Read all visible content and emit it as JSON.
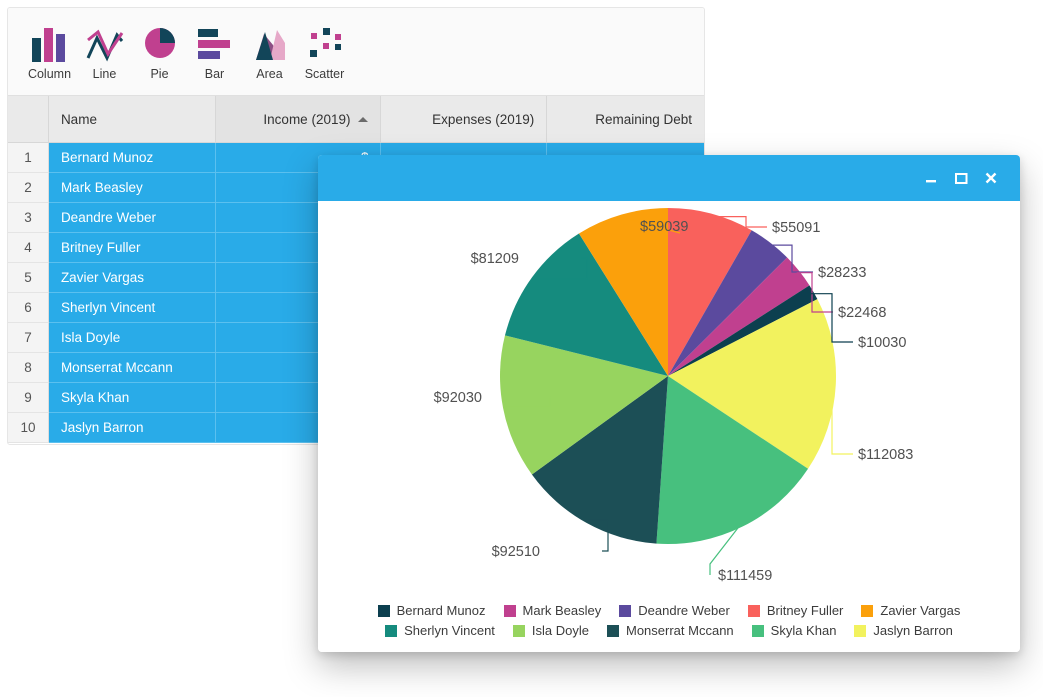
{
  "toolbar": {
    "items": [
      {
        "label": "Column",
        "icon": "column-chart-icon"
      },
      {
        "label": "Line",
        "icon": "line-chart-icon"
      },
      {
        "label": "Pie",
        "icon": "pie-chart-icon"
      },
      {
        "label": "Bar",
        "icon": "bar-chart-icon"
      },
      {
        "label": "Area",
        "icon": "area-chart-icon"
      },
      {
        "label": "Scatter",
        "icon": "scatter-chart-icon"
      }
    ]
  },
  "grid": {
    "columns": [
      {
        "key": "rownum",
        "label": ""
      },
      {
        "key": "name",
        "label": "Name"
      },
      {
        "key": "income",
        "label": "Income (2019)",
        "sorted": "ascending"
      },
      {
        "key": "expenses",
        "label": "Expenses (2019)"
      },
      {
        "key": "debt",
        "label": "Remaining Debt"
      }
    ],
    "rows": [
      {
        "num": "1",
        "name": "Bernard Munoz",
        "income": "$",
        "expenses": "",
        "debt": ""
      },
      {
        "num": "2",
        "name": "Mark Beasley",
        "income": "$",
        "expenses": "",
        "debt": ""
      },
      {
        "num": "3",
        "name": "Deandre Weber",
        "income": "$",
        "expenses": "",
        "debt": ""
      },
      {
        "num": "4",
        "name": "Britney Fuller",
        "income": "$",
        "expenses": "",
        "debt": ""
      },
      {
        "num": "5",
        "name": "Zavier Vargas",
        "income": "$",
        "expenses": "",
        "debt": ""
      },
      {
        "num": "6",
        "name": "Sherlyn Vincent",
        "income": "$",
        "expenses": "",
        "debt": ""
      },
      {
        "num": "7",
        "name": "Isla Doyle",
        "income": "$",
        "expenses": "",
        "debt": ""
      },
      {
        "num": "8",
        "name": "Monserrat Mccann",
        "income": "$",
        "expenses": "",
        "debt": ""
      },
      {
        "num": "9",
        "name": "Skyla Khan",
        "income": "$",
        "expenses": "",
        "debt": ""
      },
      {
        "num": "10",
        "name": "Jaslyn Barron",
        "income": "$",
        "expenses": "",
        "debt": ""
      }
    ]
  },
  "window": {
    "title": "",
    "buttons": [
      {
        "name": "minimize",
        "glyph": "—"
      },
      {
        "name": "maximize",
        "glyph": "☐"
      },
      {
        "name": "close",
        "glyph": "✕"
      }
    ]
  },
  "chart_data": {
    "type": "pie",
    "title": "",
    "legend_position": "bottom",
    "start_angle": 0,
    "labels_format": "$value",
    "categories": [
      "Bernard Munoz",
      "Mark Beasley",
      "Deandre Weber",
      "Britney Fuller",
      "Zavier Vargas",
      "Sherlyn Vincent",
      "Isla Doyle",
      "Monserrat Mccann",
      "Skyla Khan",
      "Jaslyn Barron"
    ],
    "values": [
      10030,
      22468,
      28233,
      55091,
      59039,
      81209,
      92030,
      92510,
      111459,
      112083
    ],
    "colors": [
      "#0c3f4f",
      "#c0408f",
      "#5b4a9e",
      "#f9615c",
      "#fba00b",
      "#158b7e",
      "#97d45f",
      "#1c4f56",
      "#47c07e",
      "#f2f25e"
    ],
    "data_labels": [
      "$10030",
      "$22468",
      "$28233",
      "$55091",
      "$59039",
      "$81209",
      "$92030",
      "$92510",
      "$111459",
      "$112083"
    ],
    "slice_order_clockwise_from_12": [
      {
        "name": "Britney Fuller",
        "value": 55091,
        "label": "$55091",
        "color": "#f9615c"
      },
      {
        "name": "Deandre Weber",
        "value": 28233,
        "label": "$28233",
        "color": "#5b4a9e"
      },
      {
        "name": "Mark Beasley",
        "value": 22468,
        "label": "$22468",
        "color": "#c0408f"
      },
      {
        "name": "Bernard Munoz",
        "value": 10030,
        "label": "$10030",
        "color": "#0c3f4f"
      },
      {
        "name": "Jaslyn Barron",
        "value": 112083,
        "label": "$112083",
        "color": "#f2f25e"
      },
      {
        "name": "Skyla Khan",
        "value": 111459,
        "label": "$111459",
        "color": "#47c07e"
      },
      {
        "name": "Monserrat Mccann",
        "value": 92510,
        "label": "$92510",
        "color": "#1c4f56"
      },
      {
        "name": "Isla Doyle",
        "value": 92030,
        "label": "$92030",
        "color": "#97d45f"
      },
      {
        "name": "Sherlyn Vincent",
        "value": 81209,
        "label": "$81209",
        "color": "#158b7e"
      },
      {
        "name": "Zavier Vargas",
        "value": 59039,
        "label": "$59039",
        "color": "#fba00b"
      }
    ],
    "legend": [
      {
        "label": "Bernard Munoz",
        "color": "#0c3f4f"
      },
      {
        "label": "Mark Beasley",
        "color": "#c0408f"
      },
      {
        "label": "Deandre Weber",
        "color": "#5b4a9e"
      },
      {
        "label": "Britney Fuller",
        "color": "#f9615c"
      },
      {
        "label": "Zavier Vargas",
        "color": "#fba00b"
      },
      {
        "label": "Sherlyn Vincent",
        "color": "#158b7e"
      },
      {
        "label": "Isla Doyle",
        "color": "#97d45f"
      },
      {
        "label": "Monserrat Mccann",
        "color": "#1c4f56"
      },
      {
        "label": "Skyla Khan",
        "color": "#47c07e"
      },
      {
        "label": "Jaslyn Barron",
        "color": "#f2f25e"
      }
    ]
  },
  "theme": {
    "accent": "#29abe8",
    "header_bg": "#eaeaea",
    "selection_bg": "#29abe8",
    "icon_dark": "#124559",
    "icon_pink": "#c0408f",
    "icon_purple": "#5b4a9e"
  }
}
